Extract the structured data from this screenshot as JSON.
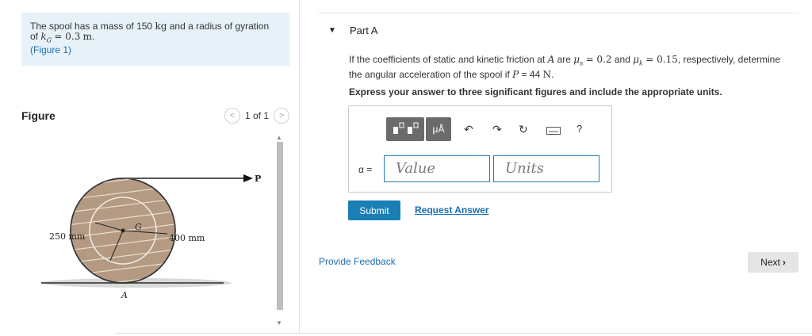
{
  "problem": {
    "text1": "The spool has a mass of 150",
    "mass_unit": "kg",
    "text2": "and a radius of gyration",
    "text3": "of",
    "kg_symbol": "k",
    "kg_sub": "G",
    "kg_value": "= 0.3",
    "kg_unit": "m",
    "figure_link": "(Figure 1)"
  },
  "figure": {
    "title": "Figure",
    "pager_prev": "<",
    "pager_text": "1 of 1",
    "pager_next": ">",
    "label_250": "250 mm",
    "label_400": "400 mm",
    "label_G": "G",
    "label_A": "A",
    "label_P": "P"
  },
  "part": {
    "toggle": "▼",
    "title": "Part A"
  },
  "question": {
    "q1": "If the coefficients of static and kinetic friction at",
    "pt_A": "A",
    "q2": "are",
    "mu_s": "μ",
    "mu_s_sub": "s",
    "mu_s_val": "= 0.2",
    "q3": "and",
    "mu_k": "μ",
    "mu_k_sub": "k",
    "mu_k_val": "= 0.15",
    "q4": ", respectively, determine",
    "q5": "the angular acceleration of the spool if",
    "P": "P",
    "P_val": "= 44",
    "P_unit": "N",
    "q6": "."
  },
  "instructions": "Express your answer to three significant figures and include the appropriate units.",
  "answer": {
    "label": "α =",
    "value_placeholder": "Value",
    "units_placeholder": "Units",
    "units_btn": "μÅ",
    "help_btn": "?"
  },
  "buttons": {
    "submit": "Submit",
    "request": "Request Answer",
    "feedback": "Provide Feedback",
    "next": "Next"
  }
}
